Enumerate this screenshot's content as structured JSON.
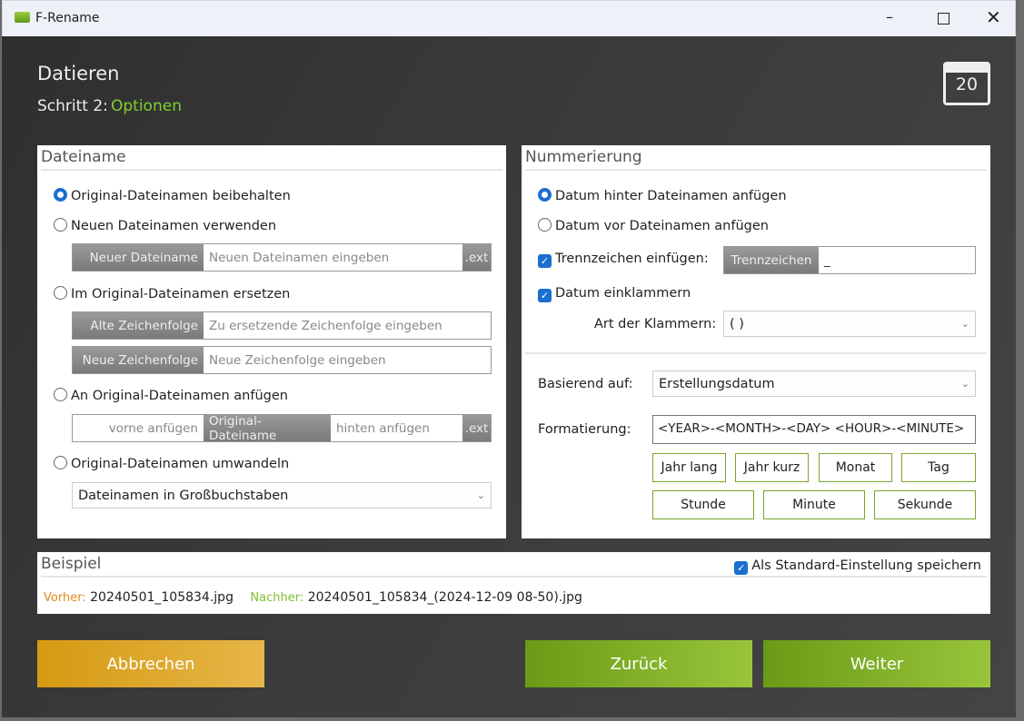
{
  "window": {
    "title": "F-Rename",
    "minimize_icon": "minimize-icon",
    "maximize_icon": "maximize-icon",
    "close_icon": "close-icon"
  },
  "header": {
    "title": "Datieren",
    "step_label": "Schritt 2:",
    "step_name": "Optionen",
    "icon": "calendar-icon",
    "icon_text": "20"
  },
  "dateiname": {
    "title": "Dateiname",
    "opt_keep": "Original-Dateinamen beibehalten",
    "opt_new": "Neuen Dateinamen verwenden",
    "new_tag": "Neuer Dateiname",
    "new_placeholder": "Neuen Dateinamen eingeben",
    "ext": ".ext",
    "opt_replace": "Im Original-Dateinamen ersetzen",
    "old_tag": "Alte Zeichenfolge",
    "old_placeholder": "Zu ersetzende Zeichenfolge eingeben",
    "repl_tag": "Neue Zeichenfolge",
    "repl_placeholder": "Neue Zeichenfolge eingeben",
    "opt_append": "An Original-Dateinamen anfügen",
    "front_placeholder": "vorne anfügen",
    "orig_tag": "Original-Dateiname",
    "back_placeholder": "hinten anfügen",
    "opt_convert": "Original-Dateinamen umwandeln",
    "convert_value": "Dateinamen in Großbuchstaben"
  },
  "nummerierung": {
    "title": "Nummerierung",
    "opt_after": "Datum hinter Dateinamen anfügen",
    "opt_before": "Datum vor Dateinamen anfügen",
    "sep_check": "Trennzeichen einfügen:",
    "sep_tag": "Trennzeichen",
    "sep_value": "_",
    "bracket_check": "Datum einklammern",
    "bracket_label": "Art der Klammern:",
    "bracket_value": "( )",
    "based_label": "Basierend auf:",
    "based_value": "Erstellungsdatum",
    "format_label": "Formatierung:",
    "format_value": "<YEAR>-<MONTH>-<DAY> <HOUR>-<MINUTE>",
    "buttons": [
      "Jahr lang",
      "Jahr kurz",
      "Monat",
      "Tag",
      "Stunde",
      "Minute",
      "Sekunde"
    ]
  },
  "beispiel": {
    "title": "Beispiel",
    "save_default": "Als Standard-Einstellung speichern",
    "before_label": "Vorher:",
    "before_value": "20240501_105834.jpg",
    "after_label": "Nachher:",
    "after_value": "20240501_105834_(2024-12-09 08-50).jpg"
  },
  "footer": {
    "cancel": "Abbrechen",
    "back": "Zurück",
    "next": "Weiter"
  },
  "colors": {
    "accent_green": "#8bc34a",
    "cancel": "#d9a11f",
    "next": "#7aa52a"
  }
}
